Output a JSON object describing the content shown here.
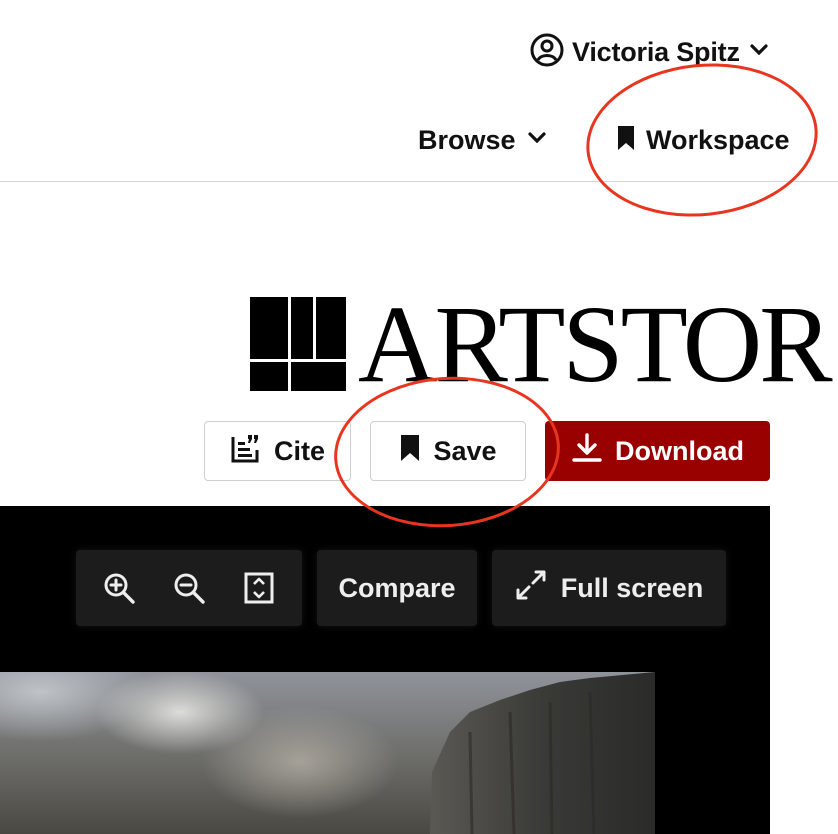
{
  "header": {
    "user_name": "Victoria Spitz",
    "browse_label": "Browse",
    "workspace_label": "Workspace"
  },
  "logo": {
    "text": "ARTSTOR"
  },
  "actions": {
    "cite_label": "Cite",
    "save_label": "Save",
    "download_label": "Download"
  },
  "viewer": {
    "compare_label": "Compare",
    "fullscreen_label": "Full screen"
  },
  "icons": {
    "user": "user-circle-icon",
    "chevron": "chevron-down-icon",
    "bookmark": "bookmark-icon",
    "cite": "cite-icon",
    "download": "download-icon",
    "zoom_in": "zoom-in-icon",
    "zoom_out": "zoom-out-icon",
    "fit": "fit-to-screen-icon",
    "fullscreen": "expand-icon"
  },
  "colors": {
    "download_bg": "#990000",
    "annotation": "#e8351f",
    "viewer_bg": "#000000"
  }
}
